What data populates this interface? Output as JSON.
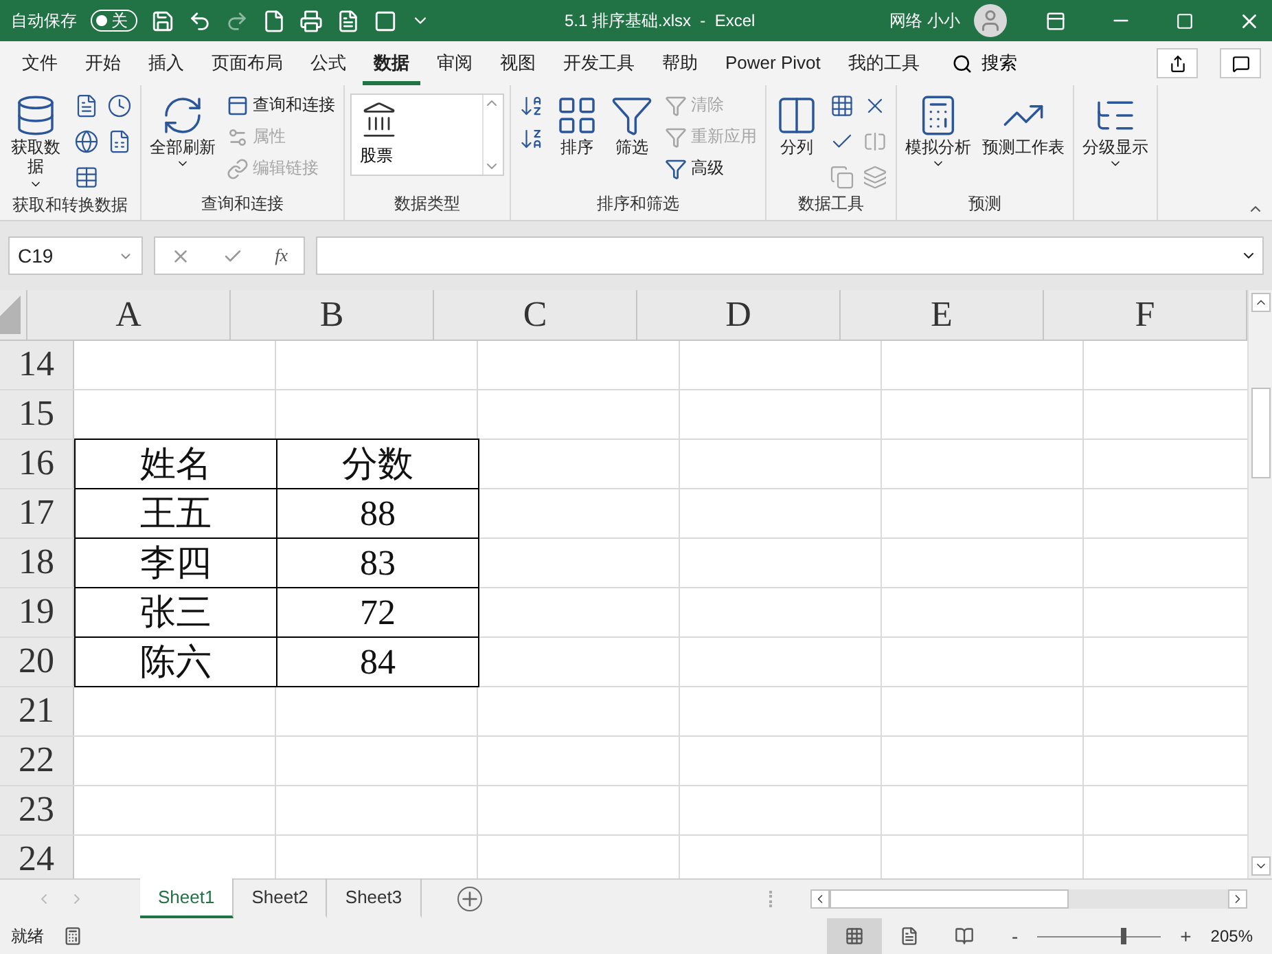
{
  "title_bar": {
    "autosave_label": "自动保存",
    "autosave": {
      "on": false,
      "label": "关"
    },
    "document_title": "5.1 排序基础.xlsx  -  Excel",
    "user": "网络 小小"
  },
  "menu_tabs": [
    {
      "label": "文件",
      "selected": false
    },
    {
      "label": "开始",
      "selected": false
    },
    {
      "label": "插入",
      "selected": false
    },
    {
      "label": "页面布局",
      "selected": false
    },
    {
      "label": "公式",
      "selected": false
    },
    {
      "label": "数据",
      "selected": true
    },
    {
      "label": "审阅",
      "selected": false
    },
    {
      "label": "视图",
      "selected": false
    },
    {
      "label": "开发工具",
      "selected": false
    },
    {
      "label": "帮助",
      "selected": false
    },
    {
      "label": "Power Pivot",
      "selected": false
    },
    {
      "label": "我的工具",
      "selected": false
    }
  ],
  "search": {
    "label": "搜索"
  },
  "ribbon_groups": [
    {
      "label": "获取和转换数据",
      "items": [
        {
          "kind": "large",
          "label": "获取数据",
          "dropdown": true,
          "disabled": false
        },
        {
          "kind": "icon",
          "disabled": false
        },
        {
          "kind": "icon",
          "disabled": false
        },
        {
          "kind": "icon",
          "disabled": false
        },
        {
          "kind": "icon",
          "disabled": false
        },
        {
          "kind": "icon",
          "disabled": false
        }
      ]
    },
    {
      "label": "查询和连接",
      "items": [
        {
          "kind": "large",
          "label": "全部刷新",
          "dropdown": true,
          "disabled": false
        },
        {
          "kind": "small",
          "label": "查询和连接",
          "disabled": false
        },
        {
          "kind": "small",
          "label": "属性",
          "disabled": true
        },
        {
          "kind": "small",
          "label": "编辑链接",
          "disabled": true
        }
      ]
    },
    {
      "label": "数据类型",
      "items": [
        {
          "kind": "gallery",
          "label": "股票",
          "disabled": false
        }
      ]
    },
    {
      "label": "排序和筛选",
      "items": [
        {
          "kind": "icon",
          "disabled": false
        },
        {
          "kind": "icon",
          "disabled": false
        },
        {
          "kind": "large",
          "label": "排序",
          "dropdown": false,
          "disabled": false
        },
        {
          "kind": "large",
          "label": "筛选",
          "dropdown": false,
          "disabled": false
        },
        {
          "kind": "small",
          "label": "清除",
          "disabled": true
        },
        {
          "kind": "small",
          "label": "重新应用",
          "disabled": true
        },
        {
          "kind": "small",
          "label": "高级",
          "disabled": false
        }
      ]
    },
    {
      "label": "数据工具",
      "items": [
        {
          "kind": "large",
          "label": "分列",
          "dropdown": false,
          "disabled": false
        },
        {
          "kind": "icon",
          "disabled": false
        },
        {
          "kind": "icon",
          "disabled": false
        },
        {
          "kind": "icon",
          "disabled": false
        },
        {
          "kind": "icon",
          "disabled": true
        },
        {
          "kind": "icon",
          "disabled": true
        },
        {
          "kind": "icon",
          "disabled": true
        }
      ]
    },
    {
      "label": "预测",
      "items": [
        {
          "kind": "large",
          "label": "模拟分析",
          "dropdown": true,
          "disabled": false
        },
        {
          "kind": "large",
          "label": "预测工作表",
          "dropdown": false,
          "disabled": false
        }
      ]
    },
    {
      "items": [
        {
          "kind": "large",
          "label": "分级显示",
          "dropdown": true,
          "disabled": false
        }
      ]
    }
  ],
  "formula_bar": {
    "name_box": "C19",
    "function_label": "fx"
  },
  "columns": [
    "A",
    "B",
    "C",
    "D",
    "E",
    "F"
  ],
  "rows": [
    {
      "header": "14"
    },
    {
      "header": "15"
    },
    {
      "header": "16",
      "cells": [
        "姓名",
        "分数"
      ]
    },
    {
      "header": "17",
      "cells": [
        "王五",
        "88"
      ]
    },
    {
      "header": "18",
      "cells": [
        "李四",
        "83"
      ]
    },
    {
      "header": "19",
      "cells": [
        "张三",
        "72"
      ]
    },
    {
      "header": "20",
      "cells": [
        "陈六",
        "84"
      ]
    },
    {
      "header": "21"
    },
    {
      "header": "22"
    },
    {
      "header": "23"
    },
    {
      "header": "24"
    }
  ],
  "sheet_tabs": [
    {
      "label": "Sheet1",
      "selected": true
    },
    {
      "label": "Sheet2",
      "selected": false
    },
    {
      "label": "Sheet3",
      "selected": false
    }
  ],
  "status_bar": {
    "status": "就绪",
    "views": [
      {
        "selected": true
      },
      {
        "selected": false
      },
      {
        "selected": false
      }
    ],
    "zoom_out": "-",
    "zoom_in": "+",
    "zoom": {
      "level": 0.68,
      "reading": "205%"
    }
  }
}
